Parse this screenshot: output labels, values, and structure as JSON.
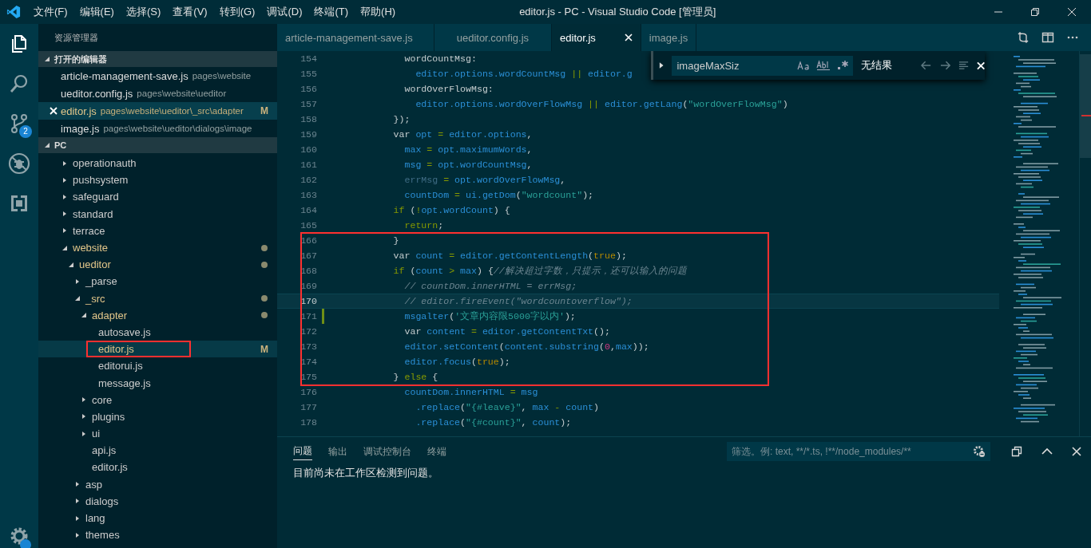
{
  "title_bar": {
    "menu": [
      "文件(F)",
      "编辑(E)",
      "选择(S)",
      "查看(V)",
      "转到(G)",
      "调试(D)",
      "终端(T)",
      "帮助(H)"
    ],
    "title": "editor.js - PC - Visual Studio Code [管理员]"
  },
  "activity_bar": {
    "items": [
      {
        "kind": "files",
        "selected": true
      },
      {
        "kind": "search",
        "selected": false
      },
      {
        "kind": "source-control",
        "selected": false,
        "badge": "2"
      },
      {
        "kind": "debug",
        "selected": false
      },
      {
        "kind": "extensions",
        "selected": false
      }
    ]
  },
  "sidebar": {
    "title": "资源管理器",
    "open_editors": {
      "title": "打开的编辑器",
      "expanded": true,
      "items": [
        {
          "name": "article-management-save.js",
          "path": "pages\\website",
          "modified": false,
          "selected": false
        },
        {
          "name": "ueditor.config.js",
          "path": "pages\\website\\ueditor",
          "modified": false,
          "selected": false
        },
        {
          "name": "editor.js",
          "path": "pages\\website\\ueditor\\_src\\adapter",
          "modified": true,
          "status": "M",
          "selected": true
        },
        {
          "name": "image.js",
          "path": "pages\\website\\ueditor\\dialogs\\image",
          "modified": false,
          "selected": false
        }
      ]
    },
    "folder": {
      "title": "PC",
      "expanded": true,
      "tree": [
        {
          "kind": "folder",
          "name": "operationauth",
          "expanded": false,
          "modified": false,
          "selected": false
        },
        {
          "kind": "folder",
          "name": "pushsystem",
          "expanded": false,
          "modified": false,
          "selected": false
        },
        {
          "kind": "folder",
          "name": "safeguard",
          "expanded": false,
          "modified": false,
          "selected": false
        },
        {
          "kind": "folder",
          "name": "standard",
          "expanded": false,
          "modified": false,
          "selected": false
        },
        {
          "kind": "folder",
          "name": "terrace",
          "expanded": false,
          "modified": false,
          "selected": false
        },
        {
          "kind": "folder",
          "name": "website",
          "expanded": true,
          "modified": true,
          "selected": false,
          "children": [
            {
              "kind": "folder",
              "name": "ueditor",
              "expanded": true,
              "modified": true,
              "selected": false,
              "children": [
                {
                  "kind": "folder",
                  "name": "_parse",
                  "expanded": false,
                  "modified": false,
                  "selected": false
                },
                {
                  "kind": "folder",
                  "name": "_src",
                  "expanded": true,
                  "modified": true,
                  "selected": false,
                  "children": [
                    {
                      "kind": "folder",
                      "name": "adapter",
                      "expanded": true,
                      "modified": true,
                      "selected": false,
                      "children": [
                        {
                          "kind": "file",
                          "name": "autosave.js",
                          "modified": false,
                          "selected": false
                        },
                        {
                          "kind": "file",
                          "name": "editor.js",
                          "modified": true,
                          "status": "M",
                          "selected": true
                        },
                        {
                          "kind": "file",
                          "name": "editorui.js",
                          "modified": false,
                          "selected": false
                        },
                        {
                          "kind": "file",
                          "name": "message.js",
                          "modified": false,
                          "selected": false
                        }
                      ]
                    },
                    {
                      "kind": "folder",
                      "name": "core",
                      "expanded": false,
                      "modified": false,
                      "selected": false
                    },
                    {
                      "kind": "folder",
                      "name": "plugins",
                      "expanded": false,
                      "modified": false,
                      "selected": false
                    },
                    {
                      "kind": "folder",
                      "name": "ui",
                      "expanded": false,
                      "modified": false,
                      "selected": false
                    },
                    {
                      "kind": "file",
                      "name": "api.js",
                      "modified": false,
                      "selected": false
                    },
                    {
                      "kind": "file",
                      "name": "editor.js",
                      "modified": false,
                      "selected": false
                    }
                  ]
                },
                {
                  "kind": "folder",
                  "name": "asp",
                  "expanded": false,
                  "modified": false,
                  "selected": false
                },
                {
                  "kind": "folder",
                  "name": "dialogs",
                  "expanded": false,
                  "modified": false,
                  "selected": false
                },
                {
                  "kind": "folder",
                  "name": "lang",
                  "expanded": false,
                  "modified": false,
                  "selected": false
                },
                {
                  "kind": "folder",
                  "name": "themes",
                  "expanded": false,
                  "modified": false,
                  "selected": false
                }
              ]
            }
          ]
        }
      ]
    }
  },
  "tabs": [
    {
      "label": "article-management-save.js",
      "selected": false
    },
    {
      "label": "ueditor.config.js",
      "selected": false
    },
    {
      "label": "editor.js",
      "selected": true
    },
    {
      "label": "image.js",
      "selected": false
    }
  ],
  "find_widget": {
    "value": "imageMaxSiz",
    "result": "无结果"
  },
  "code_lines": [
    {
      "number": "154",
      "current": false,
      "changed": false,
      "tokens": [
        {
          "kind": "key",
          "text": "            wordCountMsg:"
        }
      ]
    },
    {
      "number": "155",
      "current": false,
      "changed": false,
      "tokens": [
        {
          "kind": "ident",
          "text": "              editor.options.wordCountMsg"
        },
        {
          "kind": "op",
          "text": " || "
        },
        {
          "kind": "ident",
          "text": "editor.g"
        }
      ]
    },
    {
      "number": "156",
      "current": false,
      "changed": false,
      "tokens": [
        {
          "kind": "key",
          "text": "            wordOverFlowMsg:"
        }
      ]
    },
    {
      "number": "157",
      "current": false,
      "changed": false,
      "tokens": [
        {
          "kind": "ident",
          "text": "              editor.options.wordOverFlowMsg"
        },
        {
          "kind": "op",
          "text": " || "
        },
        {
          "kind": "ident",
          "text": "editor.getLang"
        },
        {
          "kind": "punct",
          "text": "("
        },
        {
          "kind": "string",
          "text": "\"wordOverFlowMsg\""
        },
        {
          "kind": "punct",
          "text": ")"
        }
      ]
    },
    {
      "number": "158",
      "current": false,
      "changed": false,
      "tokens": [
        {
          "kind": "punct",
          "text": "          });"
        }
      ]
    },
    {
      "number": "159",
      "current": false,
      "changed": false,
      "tokens": [
        {
          "kind": "storage",
          "text": "          var "
        },
        {
          "kind": "ident",
          "text": "opt"
        },
        {
          "kind": "op",
          "text": " = "
        },
        {
          "kind": "ident",
          "text": "editor.options"
        },
        {
          "kind": "punct",
          "text": ","
        }
      ]
    },
    {
      "number": "160",
      "current": false,
      "changed": false,
      "tokens": [
        {
          "kind": "ident",
          "text": "            max"
        },
        {
          "kind": "op",
          "text": " = "
        },
        {
          "kind": "ident",
          "text": "opt.maximumWords"
        },
        {
          "kind": "punct",
          "text": ","
        }
      ]
    },
    {
      "number": "161",
      "current": false,
      "changed": false,
      "tokens": [
        {
          "kind": "ident",
          "text": "            msg"
        },
        {
          "kind": "op",
          "text": " = "
        },
        {
          "kind": "ident",
          "text": "opt.wordCountMsg"
        },
        {
          "kind": "punct",
          "text": ","
        }
      ]
    },
    {
      "number": "162",
      "current": false,
      "changed": false,
      "tokens": [
        {
          "kind": "unused",
          "text": "            errMsg"
        },
        {
          "kind": "op",
          "text": " = "
        },
        {
          "kind": "ident",
          "text": "opt.wordOverFlowMsg"
        },
        {
          "kind": "punct",
          "text": ","
        }
      ]
    },
    {
      "number": "163",
      "current": false,
      "changed": false,
      "tokens": [
        {
          "kind": "ident",
          "text": "            countDom"
        },
        {
          "kind": "op",
          "text": " = "
        },
        {
          "kind": "ident",
          "text": "ui.getDom"
        },
        {
          "kind": "punct",
          "text": "("
        },
        {
          "kind": "string",
          "text": "\"wordcount\""
        },
        {
          "kind": "punct",
          "text": ");"
        }
      ]
    },
    {
      "number": "164",
      "current": false,
      "changed": false,
      "tokens": [
        {
          "kind": "keyword",
          "text": "          if"
        },
        {
          "kind": "punct",
          "text": " ("
        },
        {
          "kind": "op",
          "text": "!"
        },
        {
          "kind": "ident",
          "text": "opt.wordCount"
        },
        {
          "kind": "punct",
          "text": ") {"
        }
      ]
    },
    {
      "number": "165",
      "current": false,
      "changed": false,
      "tokens": [
        {
          "kind": "keyword",
          "text": "            return"
        },
        {
          "kind": "punct",
          "text": ";"
        }
      ]
    },
    {
      "number": "166",
      "current": false,
      "changed": false,
      "tokens": [
        {
          "kind": "punct",
          "text": "          }"
        }
      ]
    },
    {
      "number": "167",
      "current": false,
      "changed": false,
      "tokens": [
        {
          "kind": "storage",
          "text": "          var "
        },
        {
          "kind": "ident",
          "text": "count"
        },
        {
          "kind": "op",
          "text": " = "
        },
        {
          "kind": "ident",
          "text": "editor.getContentLength"
        },
        {
          "kind": "punct",
          "text": "("
        },
        {
          "kind": "bool",
          "text": "true"
        },
        {
          "kind": "punct",
          "text": ");"
        }
      ]
    },
    {
      "number": "168",
      "current": false,
      "changed": false,
      "tokens": [
        {
          "kind": "keyword",
          "text": "          if"
        },
        {
          "kind": "punct",
          "text": " ("
        },
        {
          "kind": "ident",
          "text": "count"
        },
        {
          "kind": "op",
          "text": " > "
        },
        {
          "kind": "ident",
          "text": "max"
        },
        {
          "kind": "punct",
          "text": ") {"
        },
        {
          "kind": "comment",
          "text": "//解决超过字数，只提示，还可以输入的问题"
        }
      ]
    },
    {
      "number": "169",
      "current": false,
      "changed": false,
      "tokens": [
        {
          "kind": "comment",
          "text": "            // countDom.innerHTML = errMsg;"
        }
      ]
    },
    {
      "number": "170",
      "current": true,
      "changed": false,
      "tokens": [
        {
          "kind": "comment",
          "text": "            // editor.fireEvent(\"wordcountoverflow\");"
        }
      ]
    },
    {
      "number": "171",
      "current": false,
      "changed": true,
      "tokens": [
        {
          "kind": "ident",
          "text": "            msgalter"
        },
        {
          "kind": "punct",
          "text": "("
        },
        {
          "kind": "string",
          "text": "'文章内容限5000字以内'"
        },
        {
          "kind": "punct",
          "text": ");"
        }
      ]
    },
    {
      "number": "172",
      "current": false,
      "changed": false,
      "tokens": [
        {
          "kind": "storage",
          "text": "            var "
        },
        {
          "kind": "ident",
          "text": "content"
        },
        {
          "kind": "op",
          "text": " = "
        },
        {
          "kind": "ident",
          "text": "editor.getContentTxt"
        },
        {
          "kind": "punct",
          "text": "();"
        }
      ]
    },
    {
      "number": "173",
      "current": false,
      "changed": false,
      "tokens": [
        {
          "kind": "ident",
          "text": "            editor.setContent"
        },
        {
          "kind": "punct",
          "text": "("
        },
        {
          "kind": "ident",
          "text": "content.substring"
        },
        {
          "kind": "punct",
          "text": "("
        },
        {
          "kind": "number",
          "text": "0"
        },
        {
          "kind": "punct",
          "text": ","
        },
        {
          "kind": "ident",
          "text": "max"
        },
        {
          "kind": "punct",
          "text": "));"
        }
      ]
    },
    {
      "number": "174",
      "current": false,
      "changed": false,
      "tokens": [
        {
          "kind": "ident",
          "text": "            editor.focus"
        },
        {
          "kind": "punct",
          "text": "("
        },
        {
          "kind": "bool",
          "text": "true"
        },
        {
          "kind": "punct",
          "text": ");"
        }
      ]
    },
    {
      "number": "175",
      "current": false,
      "changed": false,
      "tokens": [
        {
          "kind": "punct",
          "text": "          } "
        },
        {
          "kind": "keyword",
          "text": "else"
        },
        {
          "kind": "punct",
          "text": " {"
        }
      ]
    },
    {
      "number": "176",
      "current": false,
      "changed": false,
      "tokens": [
        {
          "kind": "ident",
          "text": "            countDom.innerHTML"
        },
        {
          "kind": "op",
          "text": " = "
        },
        {
          "kind": "ident",
          "text": "msg"
        }
      ]
    },
    {
      "number": "177",
      "current": false,
      "changed": false,
      "tokens": [
        {
          "kind": "ident",
          "text": "              .replace"
        },
        {
          "kind": "punct",
          "text": "("
        },
        {
          "kind": "string",
          "text": "\"{#leave}\""
        },
        {
          "kind": "punct",
          "text": ", "
        },
        {
          "kind": "ident",
          "text": "max"
        },
        {
          "kind": "op",
          "text": " - "
        },
        {
          "kind": "ident",
          "text": "count"
        },
        {
          "kind": "punct",
          "text": ")"
        }
      ]
    },
    {
      "number": "178",
      "current": false,
      "changed": false,
      "tokens": [
        {
          "kind": "ident",
          "text": "              .replace"
        },
        {
          "kind": "punct",
          "text": "("
        },
        {
          "kind": "string",
          "text": "\"{#count}\""
        },
        {
          "kind": "punct",
          "text": ", "
        },
        {
          "kind": "ident",
          "text": "count"
        },
        {
          "kind": "punct",
          "text": ");"
        }
      ]
    }
  ],
  "panel": {
    "tabs": [
      {
        "label": "问题",
        "selected": true
      },
      {
        "label": "输出",
        "selected": false
      },
      {
        "label": "调试控制台",
        "selected": false
      },
      {
        "label": "终端",
        "selected": false
      }
    ],
    "filter_placeholder": "筛选。例: text, **/*.ts, !**/node_modules/**",
    "message": "目前尚未在工作区检测到问题。"
  }
}
